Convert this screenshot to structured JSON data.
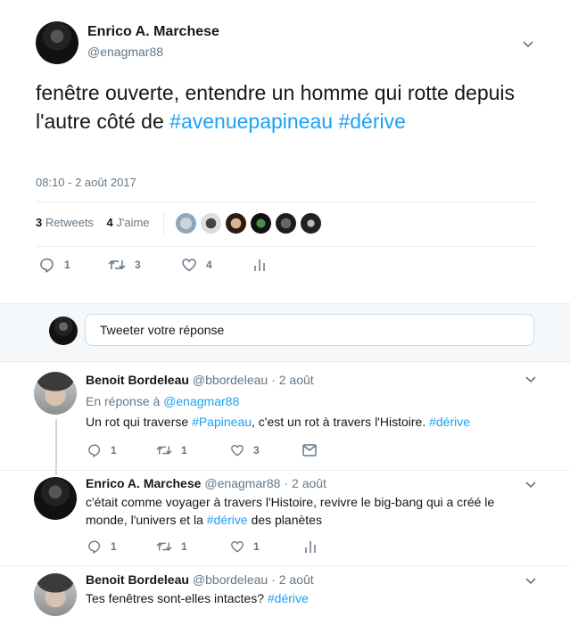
{
  "tweet": {
    "author_name": "Enrico A. Marchese",
    "author_handle": "@enagmar88",
    "text_plain": "fenêtre ouverte, entendre un homme qui rotte depuis l'autre côté de ",
    "hashtag1": "#avenuepapineau",
    "hashtag2": "#dérive",
    "timestamp": "08:10 - 2 août 2017",
    "retweets_count": "3",
    "retweets_label": "Retweets",
    "likes_count": "4",
    "likes_label": "J'aime",
    "actions": {
      "replies": "1",
      "retweets": "3",
      "likes": "4"
    }
  },
  "reply_box": {
    "placeholder": "Tweeter votre réponse"
  },
  "replies": [
    {
      "name": "Benoit Bordeleau",
      "handle": "@bbordeleau",
      "date": "· 2 août",
      "in_reply_prefix": "En réponse à",
      "in_reply_handle": "@enagmar88",
      "text_a": "Un rot qui traverse ",
      "hashtag_a": "#Papineau",
      "text_b": ", c'est un rot à travers l'Histoire. ",
      "hashtag_b": "#dérive",
      "actions": {
        "replies": "1",
        "retweets": "1",
        "likes": "3"
      }
    },
    {
      "name": "Enrico A. Marchese",
      "handle": "@enagmar88",
      "date": "· 2 août",
      "text_a": "c'était comme voyager à travers l'Histoire, revivre le big-bang qui a créé le monde, l'univers et la ",
      "hashtag_a": "#dérive",
      "text_b": " des planètes",
      "actions": {
        "replies": "1",
        "retweets": "1",
        "likes": "1"
      }
    },
    {
      "name": "Benoit Bordeleau",
      "handle": "@bbordeleau",
      "date": "· 2 août",
      "text_a": "Tes fenêtres sont-elles intactes? ",
      "hashtag_a": "#dérive"
    }
  ],
  "icons": {
    "reply": "reply-icon",
    "retweet": "retweet-icon",
    "like": "heart-icon",
    "analytics": "analytics-icon",
    "message": "envelope-icon",
    "more": "chevron-down-icon"
  },
  "colors": {
    "link": "#1da1f2",
    "muted": "#657786",
    "text": "#14171a",
    "divider": "#e6ecf0"
  }
}
